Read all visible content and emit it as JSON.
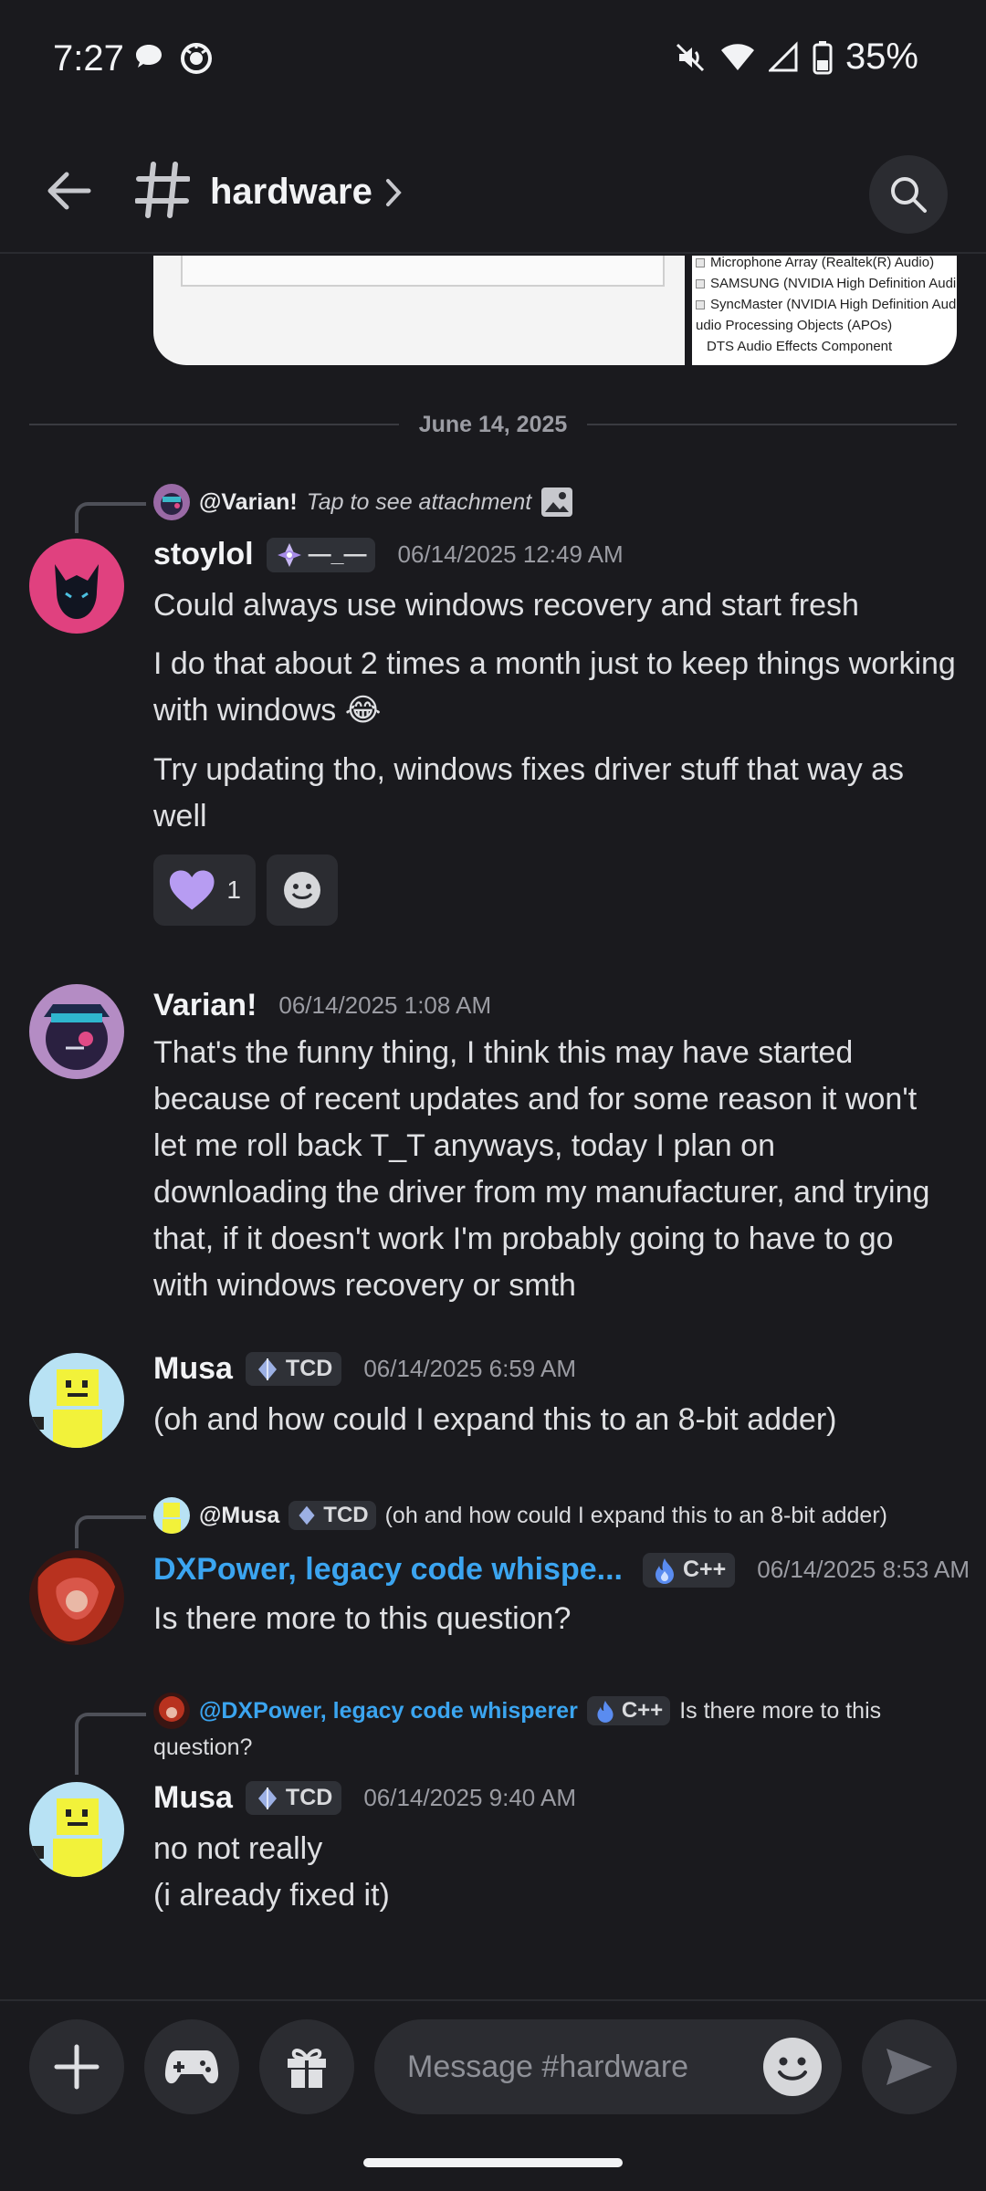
{
  "status_bar": {
    "time": "7:27",
    "battery": "35%"
  },
  "header": {
    "channel_name": "hardware"
  },
  "attachment_preview": {
    "lines": [
      "Microphone Array (Realtek(R) Audio)",
      "SAMSUNG (NVIDIA High Definition Audi",
      "SyncMaster (NVIDIA High Definition Aud",
      "udio Processing Objects (APOs)",
      "DTS Audio Effects Component"
    ]
  },
  "date_divider": "June 14, 2025",
  "messages": [
    {
      "reply": {
        "name": "@Varian!",
        "text": "Tap to see attachment"
      },
      "author": "stoylol",
      "tag": "—_—",
      "timestamp": "06/14/2025 12:49 AM",
      "paragraphs": [
        "Could always use windows recovery and start fresh",
        "I do that about 2 times a month just to keep things working with windows 😂",
        "Try updating tho, windows fixes driver stuff that way as well"
      ],
      "reactions": [
        {
          "emoji": "purple-heart",
          "count": "1"
        }
      ]
    },
    {
      "author": "Varian!",
      "timestamp": "06/14/2025 1:08 AM",
      "text": "That's the funny thing, I think this may have started because of recent updates and for some reason it won't let me roll back T_T anyways, today I plan on downloading the driver from my manufacturer, and trying that, if it doesn't work I'm probably going to have to go with windows recovery or smth"
    },
    {
      "author": "Musa",
      "tag": "TCD",
      "timestamp": "06/14/2025 6:59 AM",
      "text": "(oh and  how could I expand this to an 8-bit adder)"
    },
    {
      "reply": {
        "name": "@Musa",
        "tag": "TCD",
        "text": "(oh and  how could I expand this to an 8-bit adder)"
      },
      "author": "DXPower, legacy code whispe...",
      "tag": "C++",
      "timestamp": "06/14/2025 8:53 AM",
      "text": "Is there more to this question?"
    },
    {
      "reply": {
        "name": "@DXPower, legacy code whisperer",
        "tag": "C++",
        "text": "Is there more to this",
        "text2": "question?"
      },
      "author": "Musa",
      "tag": "TCD",
      "timestamp": "06/14/2025 9:40 AM",
      "line1": "no not really",
      "line2": "(i already fixed it)"
    }
  ],
  "composer": {
    "placeholder": "Message #hardware"
  },
  "colors": {
    "background": "#1a1a1e",
    "accent_blue": "#3ba5f0",
    "reaction_heart": "#b79cf2"
  }
}
